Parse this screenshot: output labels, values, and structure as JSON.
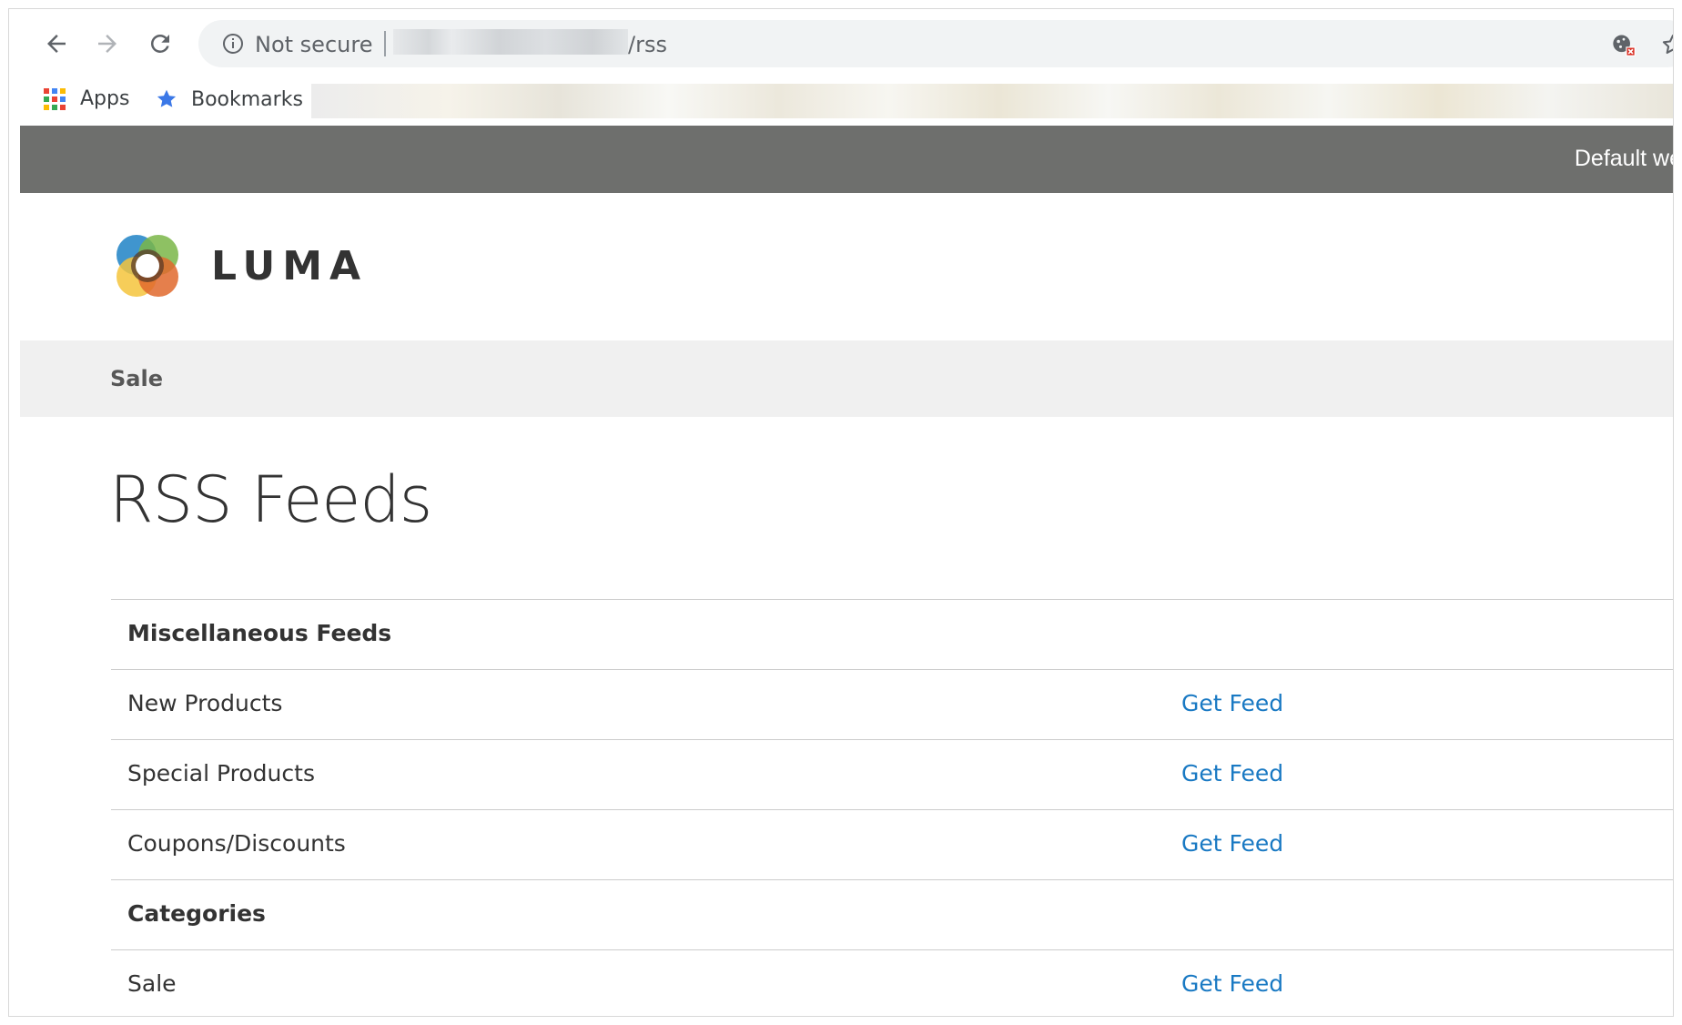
{
  "browser": {
    "security_label": "Not secure",
    "url_path": "/rss",
    "bookmarks_bar": {
      "apps_label": "Apps",
      "bookmarks_label": "Bookmarks"
    },
    "apps_colors": [
      "#ea4335",
      "#4285f4",
      "#fbbc05",
      "#34a853",
      "#ea4335",
      "#4285f4",
      "#fbbc05",
      "#34a853",
      "#ea4335"
    ]
  },
  "store": {
    "switcher_label": "Default we",
    "logo_text": "LUMA",
    "nav": [
      {
        "label": "Sale"
      }
    ]
  },
  "page": {
    "title": "RSS Feeds",
    "rows": [
      {
        "type": "section",
        "label": "Miscellaneous Feeds"
      },
      {
        "type": "feed",
        "label": "New Products",
        "link": "Get Feed"
      },
      {
        "type": "feed",
        "label": "Special Products",
        "link": "Get Feed"
      },
      {
        "type": "feed",
        "label": "Coupons/Discounts",
        "link": "Get Feed"
      },
      {
        "type": "section",
        "label": "Categories"
      },
      {
        "type": "feed",
        "label": "Sale",
        "link": "Get Feed"
      }
    ]
  },
  "colors": {
    "link": "#1979c3",
    "header_bg": "#6e6f6d",
    "nav_bg": "#f0f0f0"
  },
  "icons": {
    "back": "arrow-left-icon",
    "forward": "arrow-right-icon",
    "reload": "reload-icon",
    "info": "info-icon",
    "blocked": "cookie-blocked-icon",
    "bookmark": "star-outline-icon",
    "apps": "apps-grid-icon",
    "bookmarks": "star-filled-icon"
  }
}
